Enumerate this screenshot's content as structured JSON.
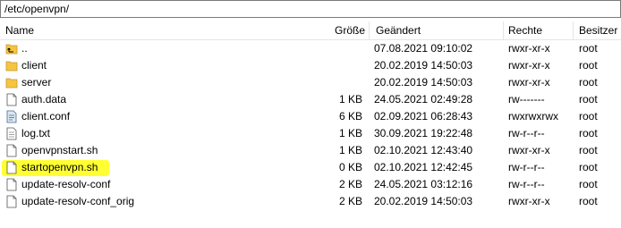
{
  "path": "/etc/openvpn/",
  "columns": {
    "name": "Name",
    "size": "Größe",
    "modified": "Geändert",
    "perms": "Rechte",
    "owner": "Besitzer"
  },
  "files": [
    {
      "name": "..",
      "size": "",
      "modified": "07.08.2021 09:10:02",
      "perms": "rwxr-xr-x",
      "owner": "root",
      "icon": "parent-folder-icon"
    },
    {
      "name": "client",
      "size": "",
      "modified": "20.02.2019 14:50:03",
      "perms": "rwxr-xr-x",
      "owner": "root",
      "icon": "folder-icon"
    },
    {
      "name": "server",
      "size": "",
      "modified": "20.02.2019 14:50:03",
      "perms": "rwxr-xr-x",
      "owner": "root",
      "icon": "folder-icon"
    },
    {
      "name": "auth.data",
      "size": "1 KB",
      "modified": "24.05.2021 02:49:28",
      "perms": "rw-------",
      "owner": "root",
      "icon": "file-icon"
    },
    {
      "name": "client.conf",
      "size": "6 KB",
      "modified": "02.09.2021 06:28:43",
      "perms": "rwxrwxrwx",
      "owner": "root",
      "icon": "config-file-icon"
    },
    {
      "name": "log.txt",
      "size": "1 KB",
      "modified": "30.09.2021 19:22:48",
      "perms": "rw-r--r--",
      "owner": "root",
      "icon": "text-file-icon"
    },
    {
      "name": "openvpnstart.sh",
      "size": "1 KB",
      "modified": "02.10.2021 12:43:40",
      "perms": "rwxr-xr-x",
      "owner": "root",
      "icon": "file-icon"
    },
    {
      "name": "startopenvpn.sh",
      "size": "0 KB",
      "modified": "02.10.2021 12:42:45",
      "perms": "rw-r--r--",
      "owner": "root",
      "icon": "file-icon",
      "highlighted": true
    },
    {
      "name": "update-resolv-conf",
      "size": "2 KB",
      "modified": "24.05.2021 03:12:16",
      "perms": "rw-r--r--",
      "owner": "root",
      "icon": "file-icon"
    },
    {
      "name": "update-resolv-conf_orig",
      "size": "2 KB",
      "modified": "20.02.2019 14:50:03",
      "perms": "rwxr-xr-x",
      "owner": "root",
      "icon": "file-icon"
    }
  ],
  "colors": {
    "highlight": "#ffff32",
    "folder": "#f5c542"
  }
}
